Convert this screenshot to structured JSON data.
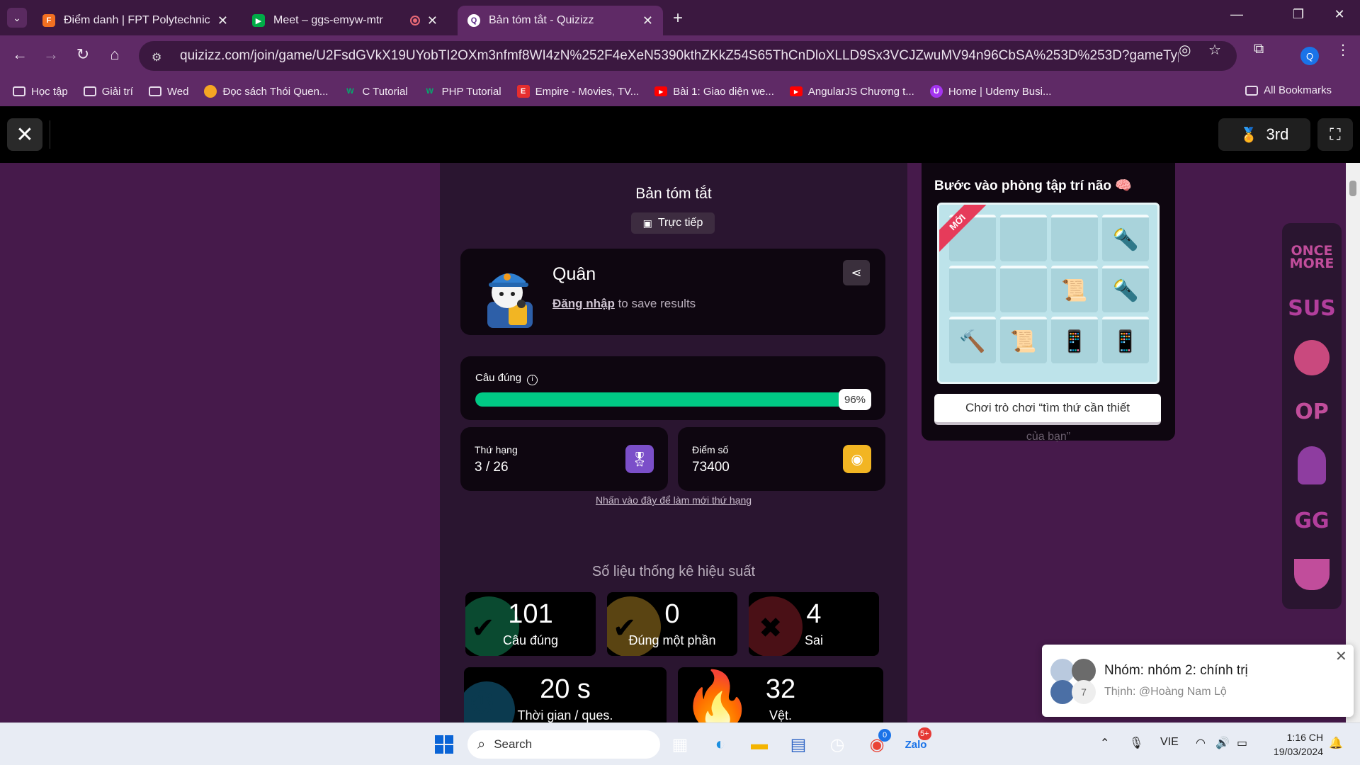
{
  "browser": {
    "tabs": [
      {
        "title": "Điểm danh | FPT Polytechnic",
        "active": false
      },
      {
        "title": "Meet – ggs-emyw-mtr",
        "active": false
      },
      {
        "title": "Bản tóm tắt - Quizizz",
        "active": true
      }
    ],
    "url": "quizizz.com/join/game/U2FsdGVkX19UYobTI2OXm3nfmf8WI4zN%252F4eXeN5390kthZKkZ54S65ThCnDloXLLD9Sx3VCJZwuMV94n96CbSA%253D%253D?gameType=live&page=sum...",
    "profile_initial": "Q",
    "bookmarks": [
      {
        "label": "Học tập",
        "icon": "folder-icon"
      },
      {
        "label": "Giải trí",
        "icon": "folder-icon"
      },
      {
        "label": "Wed",
        "icon": "folder-icon"
      },
      {
        "label": "Đọc sách Thói Quen...",
        "icon": "book-favicon"
      },
      {
        "label": "C Tutorial",
        "icon": "w3-favicon"
      },
      {
        "label": "PHP Tutorial",
        "icon": "w3-favicon"
      },
      {
        "label": "Empire - Movies, TV...",
        "icon": "empire-favicon"
      },
      {
        "label": "Bài 1: Giao diện we...",
        "icon": "youtube-favicon"
      },
      {
        "label": "AngularJS Chương t...",
        "icon": "youtube-favicon"
      },
      {
        "label": "Home | Udemy Busi...",
        "icon": "udemy-favicon"
      }
    ],
    "all_bookmarks": "All Bookmarks"
  },
  "quiz_header": {
    "rank_badge": "3rd"
  },
  "summary": {
    "title": "Bản tóm tắt",
    "live_label": "Trực tiếp",
    "player_name": "Quân",
    "login_link": "Đăng nhập",
    "login_suffix": " to save results",
    "accuracy_label": "Câu đúng",
    "accuracy_percent": 96,
    "accuracy_text": "96%",
    "rank_label": "Thứ hạng",
    "rank_value": "3 / 26",
    "score_label": "Điểm số",
    "score_value": "73400",
    "refresh_link": "Nhấn vào đây để làm mới thứ hạng",
    "perf_title": "Số liệu thống kê hiệu suất",
    "perf": {
      "correct": {
        "value": "101",
        "label": "Câu đúng"
      },
      "partial": {
        "value": "0",
        "label": "Đúng một phần"
      },
      "wrong": {
        "value": "4",
        "label": "Sai"
      },
      "time": {
        "value": "20 s",
        "label": "Thời gian / ques."
      },
      "streak": {
        "value": "32",
        "label": "Vệt."
      }
    }
  },
  "promo": {
    "title": "Bước vào phòng tập trí não",
    "ribbon": "MỚI",
    "button": "Chơi trò chơi “tìm thứ cần thiết",
    "button_cont": "của bạn”",
    "cells": [
      "",
      "",
      "",
      "flashlight",
      "",
      "",
      "scroll",
      "flashlight",
      "hammer",
      "scroll",
      "phone",
      "phone"
    ]
  },
  "side_games": [
    "ONCE MORE",
    "SUS",
    "monkey",
    "OP",
    "among-us",
    "GG",
    "cup"
  ],
  "notification": {
    "title": "Nhóm: nhóm 2: chính trị",
    "body": "Thịnh: @Hoàng Nam Lộ",
    "member_count": "7"
  },
  "taskbar": {
    "search_label": "Search",
    "lang": "VIE",
    "time": "1:16 CH",
    "date": "19/03/2024",
    "chrome_badge": "0",
    "zalo_badge": "5+"
  },
  "colors": {
    "page_bg": "#461a4b",
    "accuracy_green": "#00c985",
    "rank_purple": "#8c74f2",
    "score_gold": "#f2b523"
  }
}
